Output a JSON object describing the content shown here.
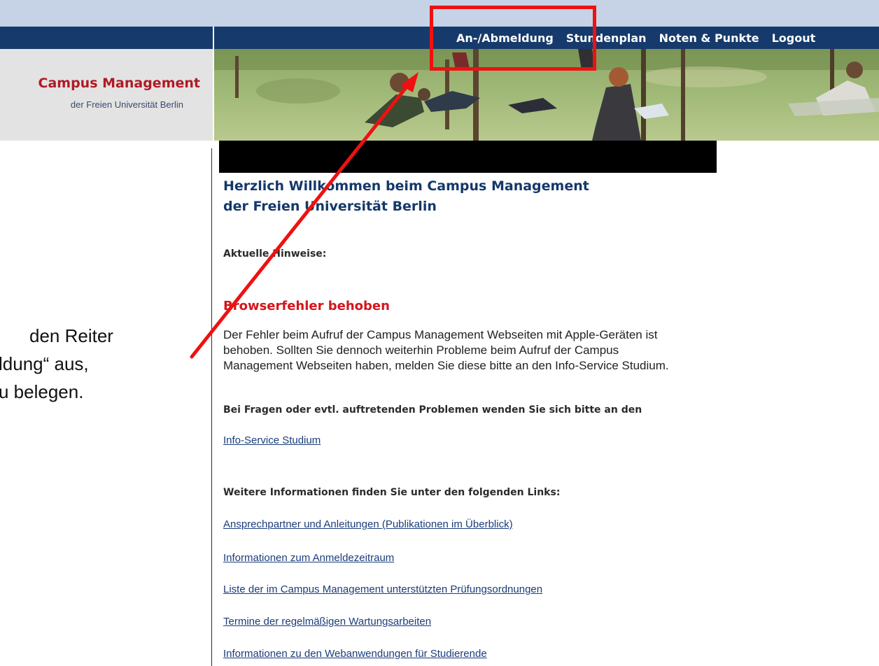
{
  "header": {
    "nav": [
      "An-/Abmeldung",
      "Stundenplan",
      "Noten & Punkte",
      "Logout"
    ]
  },
  "logo": {
    "title": "Campus Management",
    "subtitle": "der Freien Universität Berlin"
  },
  "main": {
    "welcome_line1": "Herzlich Willkommen beim Campus Management",
    "welcome_line2": "der Freien Universität Berlin",
    "current_notes_label": "Aktuelle Hinweise:",
    "notice_heading": "Browserfehler behoben",
    "notice_lines": [
      "Der Fehler beim Aufruf der Campus Management Webseiten mit Apple-Geräten ist",
      "behoben. Sollten Sie dennoch weiterhin Probleme beim Aufruf der Campus",
      "Management Webseiten haben, melden Sie diese bitte an den Info-Service Studium."
    ],
    "questions_text": "Bei Fragen oder evtl. auftretenden Problemen wenden Sie sich bitte an den",
    "info_service_link": "Info-Service Studium",
    "more_info_text": "Weitere Informationen finden Sie unter den folgenden Links:",
    "links": [
      "Ansprechpartner und Anleitungen (Publikationen im Überblick)",
      "Informationen zum Anmeldezeitraum",
      "Liste der im Campus Management unterstützten Prüfungsordnungen",
      "Termine der regelmäßigen Wartungsarbeiten",
      "Informationen zu den Webanwendungen für Studierende"
    ]
  },
  "annotation": {
    "lines": [
      "den Reiter",
      "ldung“ aus,",
      "u belegen."
    ],
    "color": "#ee1111"
  },
  "colors": {
    "nav_bar": "#163a6b",
    "top_strip": "#c6d3e6",
    "logo_red": "#b11a24",
    "heading_blue": "#14386a",
    "notice_red": "#d4161c",
    "link_blue": "#1a3d7a"
  }
}
